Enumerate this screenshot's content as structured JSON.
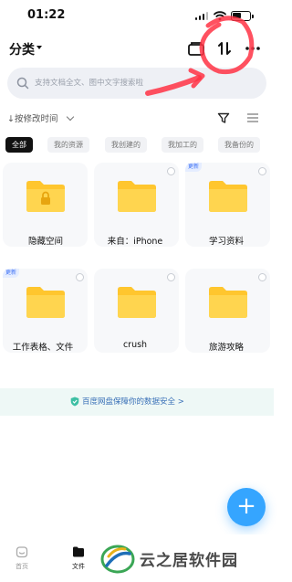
{
  "status_bar": {
    "time": "01:22"
  },
  "header": {
    "title": "分类"
  },
  "search": {
    "placeholder": "支持文档全文、图中文字搜索啦"
  },
  "sort": {
    "label": "↓按修改时间"
  },
  "filter_chips": [
    {
      "label": "全部",
      "active": true
    },
    {
      "label": "我的资源",
      "active": false
    },
    {
      "label": "我创建的",
      "active": false
    },
    {
      "label": "我加工的",
      "active": false
    },
    {
      "label": "我备份的",
      "active": false
    }
  ],
  "folders": [
    {
      "name": "隐藏空间",
      "locked": true,
      "badge": ""
    },
    {
      "name": "来自：iPhone",
      "locked": false,
      "badge": ""
    },
    {
      "name": "学习资料",
      "locked": false,
      "badge": "更新"
    },
    {
      "name": "工作表格、文件",
      "locked": false,
      "badge": "更新"
    },
    {
      "name": "crush",
      "locked": false,
      "badge": ""
    },
    {
      "name": "旅游攻略",
      "locked": false,
      "badge": ""
    }
  ],
  "safety_notice": "百度网盘保障你的数据安全 >",
  "fab": {
    "label": "+"
  },
  "tabbar": [
    {
      "label": "首页",
      "active": false
    },
    {
      "label": "文件",
      "active": true
    }
  ],
  "watermark": {
    "text": "云之居软件园"
  },
  "colors": {
    "accent": "#35a5ff",
    "folder": "#ffcc33",
    "annotation": "#ff3344",
    "badge_text": "#3b6ff5"
  }
}
